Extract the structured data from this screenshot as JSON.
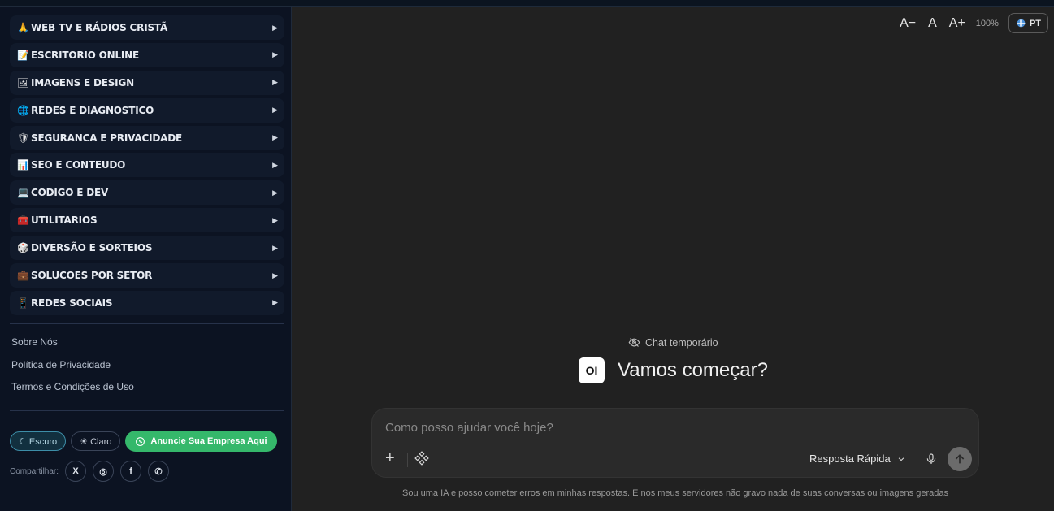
{
  "sidebar": {
    "items": [
      {
        "emoji": "🙏",
        "label": "WEB TV E RÁDIOS CRISTÃ"
      },
      {
        "emoji": "📝",
        "label": "ESCRITORIO ONLINE"
      },
      {
        "emoji": "🖼",
        "label": "IMAGENS E DESIGN"
      },
      {
        "emoji": "🌐",
        "label": "REDES E DIAGNOSTICO"
      },
      {
        "emoji": "🛡",
        "label": "SEGURANCA E PRIVACIDADE"
      },
      {
        "emoji": "📊",
        "label": "SEO E CONTEUDO"
      },
      {
        "emoji": "💻",
        "label": "CODIGO E DEV"
      },
      {
        "emoji": "🧰",
        "label": "UTILITARIOS"
      },
      {
        "emoji": "🎲",
        "label": "DIVERSÃO E SORTEIOS"
      },
      {
        "emoji": "💼",
        "label": "SOLUCOES POR SETOR"
      },
      {
        "emoji": "📱",
        "label": "REDES SOCIAIS"
      }
    ],
    "arrow": "▶",
    "links": [
      "Sobre Nós",
      "Política de Privacidade",
      "Termos e Condições de Uso"
    ],
    "theme_dark": "☾ Escuro",
    "theme_light": "☀ Claro",
    "advertise": "Anuncie Sua Empresa Aqui",
    "share_label": "Compartilhar:",
    "share": [
      "X",
      "◎",
      "f",
      "✆"
    ]
  },
  "topbar": {
    "decrease": "A−",
    "normal": "A",
    "increase": "A+",
    "zoom": "100%",
    "lang": "PT"
  },
  "chat": {
    "temporary": "Chat temporário",
    "logo": "OI",
    "greeting": "Vamos começar?",
    "placeholder": "Como posso ajudar você hoje?",
    "model": "Resposta Rápida",
    "disclaimer": "Sou uma IA e posso cometer erros em minhas respostas. E nos meus servidores não gravo nada de suas conversas ou imagens geradas"
  }
}
